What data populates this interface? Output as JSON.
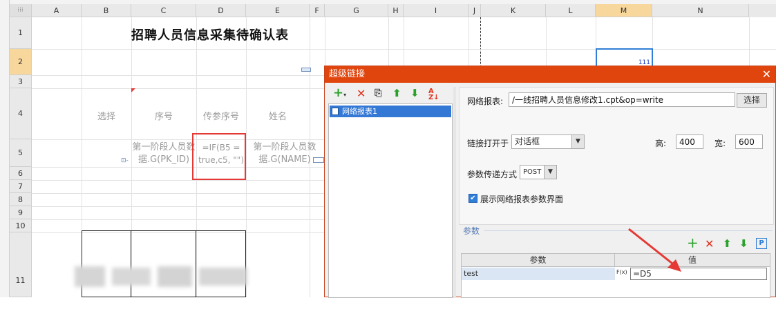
{
  "sheet": {
    "columns": [
      "A",
      "B",
      "C",
      "D",
      "E",
      "F",
      "G",
      "H",
      "I",
      "J",
      "K",
      "L",
      "M",
      "N"
    ],
    "rows": [
      "1",
      "2",
      "3",
      "4",
      "5",
      "6",
      "7",
      "8",
      "9",
      "10",
      "11"
    ],
    "title": "招聘人员信息采集待确认表",
    "cell_m2": "111",
    "headers": {
      "b4": "选择",
      "c4": "序号",
      "d4": "传参序号",
      "e4": "姓名"
    },
    "c5": "第一阶段人员数据.G(PK_ID)",
    "d5": "=IF(B5 = true,c5, \"\")",
    "e5": "第一阶段人员数据.G(NAME)"
  },
  "dialog": {
    "title": "超级链接",
    "close": "✕",
    "tree_item": "网络报表1",
    "report_label": "网络报表:",
    "report_value": "/一线招聘人员信息修改1.cpt&op=write",
    "choose_button": "选择",
    "open_in_label": "链接打开于",
    "open_in_value": "对话框",
    "height_label": "高:",
    "height_value": "400",
    "width_label": "宽:",
    "width_value": "600",
    "method_label": "参数传递方式",
    "method_value": "POST",
    "show_params_label": "展示网络报表参数界面",
    "show_params_checked": true,
    "params_section": "参数",
    "param_col_name": "参数",
    "param_col_value": "值",
    "param_name": "test",
    "param_fx": "F(x)",
    "param_value": "=D5"
  },
  "colors": {
    "accent": "#e0450e",
    "selection": "#3478d6",
    "highlight": "#e53935"
  }
}
